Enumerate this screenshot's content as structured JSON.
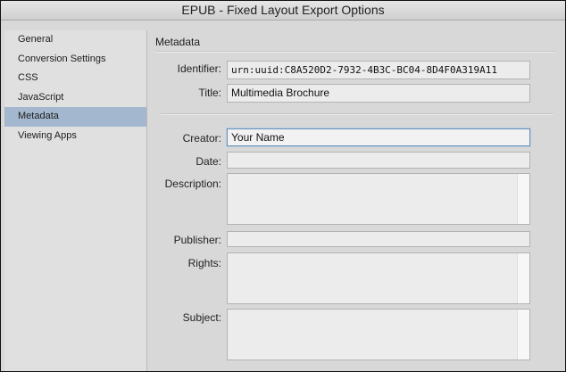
{
  "window": {
    "title": "EPUB - Fixed Layout Export Options"
  },
  "sidebar": {
    "items": [
      {
        "label": "General",
        "selected": false
      },
      {
        "label": "Conversion Settings",
        "selected": false
      },
      {
        "label": "CSS",
        "selected": false
      },
      {
        "label": "JavaScript",
        "selected": false
      },
      {
        "label": "Metadata",
        "selected": true
      },
      {
        "label": "Viewing Apps",
        "selected": false
      }
    ]
  },
  "metadata": {
    "section_title": "Metadata",
    "identifier": {
      "label": "Identifier:",
      "value": "urn:uuid:C8A520D2-7932-4B3C-BC04-8D4F0A319A11"
    },
    "title": {
      "label": "Title:",
      "value": "Multimedia Brochure"
    },
    "creator": {
      "label": "Creator:",
      "value": "Your Name"
    },
    "date": {
      "label": "Date:",
      "value": ""
    },
    "description": {
      "label": "Description:",
      "value": ""
    },
    "publisher": {
      "label": "Publisher:",
      "value": ""
    },
    "rights": {
      "label": "Rights:",
      "value": ""
    },
    "subject": {
      "label": "Subject:",
      "value": ""
    }
  },
  "colors": {
    "selection": "#a3b8cf",
    "focus_ring": "#6c8fb5"
  }
}
